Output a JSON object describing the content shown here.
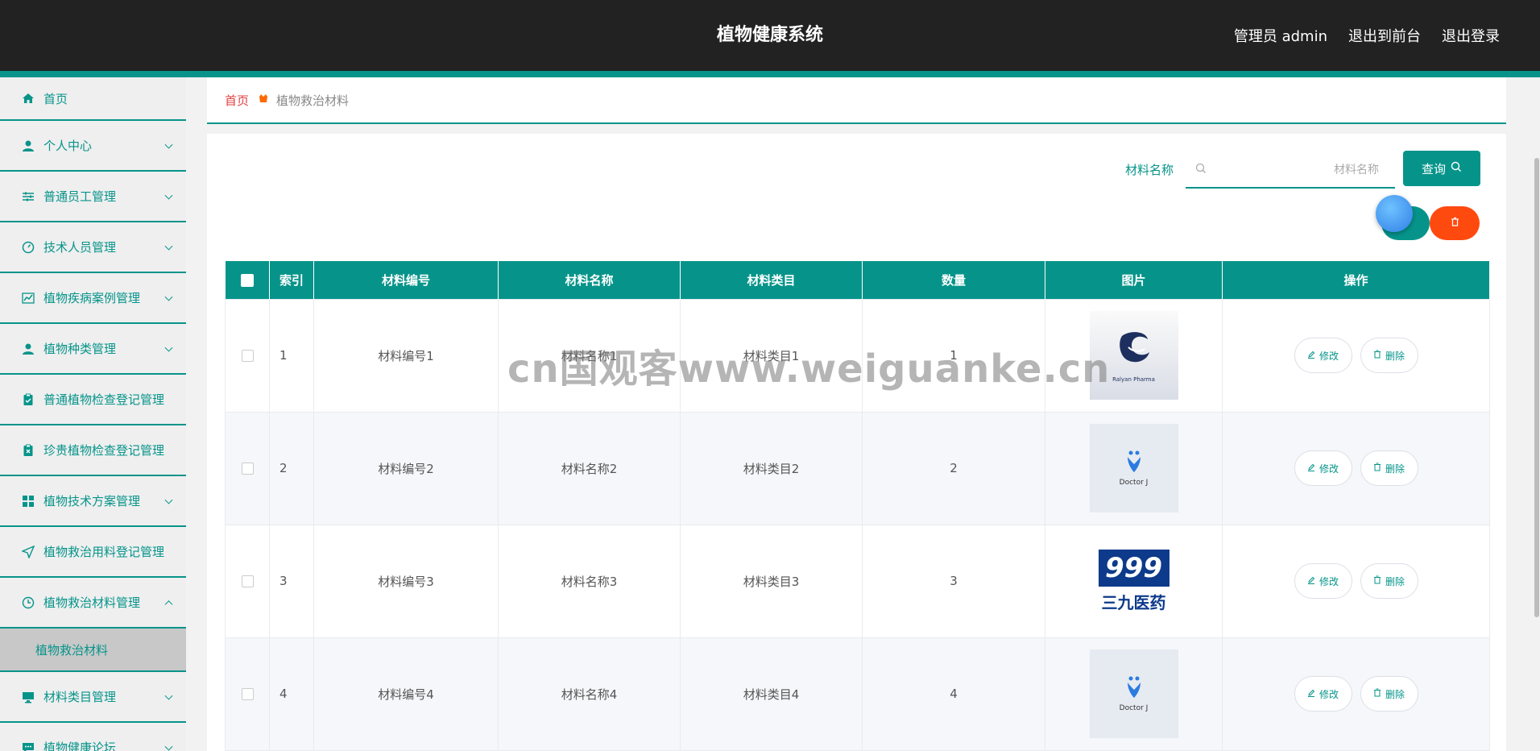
{
  "header": {
    "title": "植物健康系统",
    "admin_label": "管理员 admin",
    "to_front_label": "退出到前台",
    "logout_label": "退出登录"
  },
  "sidebar": {
    "items": [
      {
        "label": "首页",
        "icon": "home-icon"
      },
      {
        "label": "个人中心",
        "icon": "user-icon"
      },
      {
        "label": "普通员工管理",
        "icon": "sliders-icon"
      },
      {
        "label": "技术人员管理",
        "icon": "gauge-icon"
      },
      {
        "label": "植物疾病案例管理",
        "icon": "chart-icon"
      },
      {
        "label": "植物种类管理",
        "icon": "user-icon"
      },
      {
        "label": "普通植物检查登记管理",
        "icon": "clipboard-icon"
      },
      {
        "label": "珍贵植物检查登记管理",
        "icon": "clipboard-icon"
      },
      {
        "label": "植物技术方案管理",
        "icon": "grid-icon"
      },
      {
        "label": "植物救治用料登记管理",
        "icon": "send-icon"
      },
      {
        "label": "植物救治材料管理",
        "icon": "clock-icon"
      },
      {
        "label": "材料类目管理",
        "icon": "monitor-icon"
      },
      {
        "label": "植物健康论坛",
        "icon": "chat-icon"
      }
    ],
    "sub_item": "植物救治材料"
  },
  "breadcrumb": {
    "home": "首页",
    "current": "植物救治材料"
  },
  "search": {
    "label": "材料名称",
    "placeholder": "材料名称",
    "button": "查询"
  },
  "table": {
    "headers": [
      "索引",
      "材料编号",
      "材料名称",
      "材料类目",
      "数量",
      "图片",
      "操作"
    ],
    "rows": [
      {
        "index": "1",
        "code": "材料编号1",
        "name": "材料名称1",
        "category": "材料类目1",
        "qty": "1",
        "image_text": "Ralyan Pharma"
      },
      {
        "index": "2",
        "code": "材料编号2",
        "name": "材料名称2",
        "category": "材料类目2",
        "qty": "2",
        "image_text": "Doctor J"
      },
      {
        "index": "3",
        "code": "材料编号3",
        "name": "材料名称3",
        "category": "材料类目3",
        "qty": "3",
        "image_text": "三九医药"
      },
      {
        "index": "4",
        "code": "材料编号4",
        "name": "材料名称4",
        "category": "材料类目4",
        "qty": "4",
        "image_text": "Doctor J"
      }
    ],
    "edit_label": "修改",
    "delete_label": "删除"
  },
  "watermark": "cn国观客www.weiguanke.cn",
  "colors": {
    "accent": "#06948a",
    "header": "#222222",
    "danger": "#ff4a0f"
  }
}
